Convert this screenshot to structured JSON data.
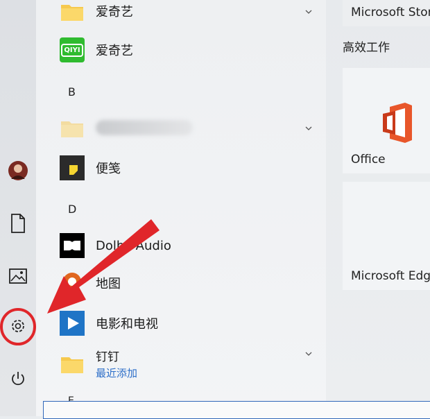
{
  "app_list": {
    "top_folder": {
      "label": "爱奇艺"
    },
    "iqiyi_app": {
      "label": "爱奇艺",
      "logo_text": "QIYI"
    },
    "letter_b": "B",
    "letter_d": "D",
    "sticky_notes": {
      "label": "便笺"
    },
    "dolby_audio": {
      "label": "Dolby Audio"
    },
    "maps": {
      "label": "地图"
    },
    "movies_tv": {
      "label": "电影和电视"
    },
    "dingtalk_folder": {
      "label": "钉钉",
      "sub_label": "最近添加"
    },
    "letter_e": "E"
  },
  "tiles": {
    "store_label": "Microsoft Store",
    "group_title": "高效工作",
    "office_label": "Office",
    "edge_label": "Microsoft Edge"
  },
  "rail": {
    "items": [
      "user-avatar",
      "documents",
      "pictures",
      "settings",
      "power"
    ]
  },
  "colors": {
    "annotation_red": "#e0262a",
    "accent_blue": "#2d6fc9",
    "office_orange": "#e8562a"
  }
}
